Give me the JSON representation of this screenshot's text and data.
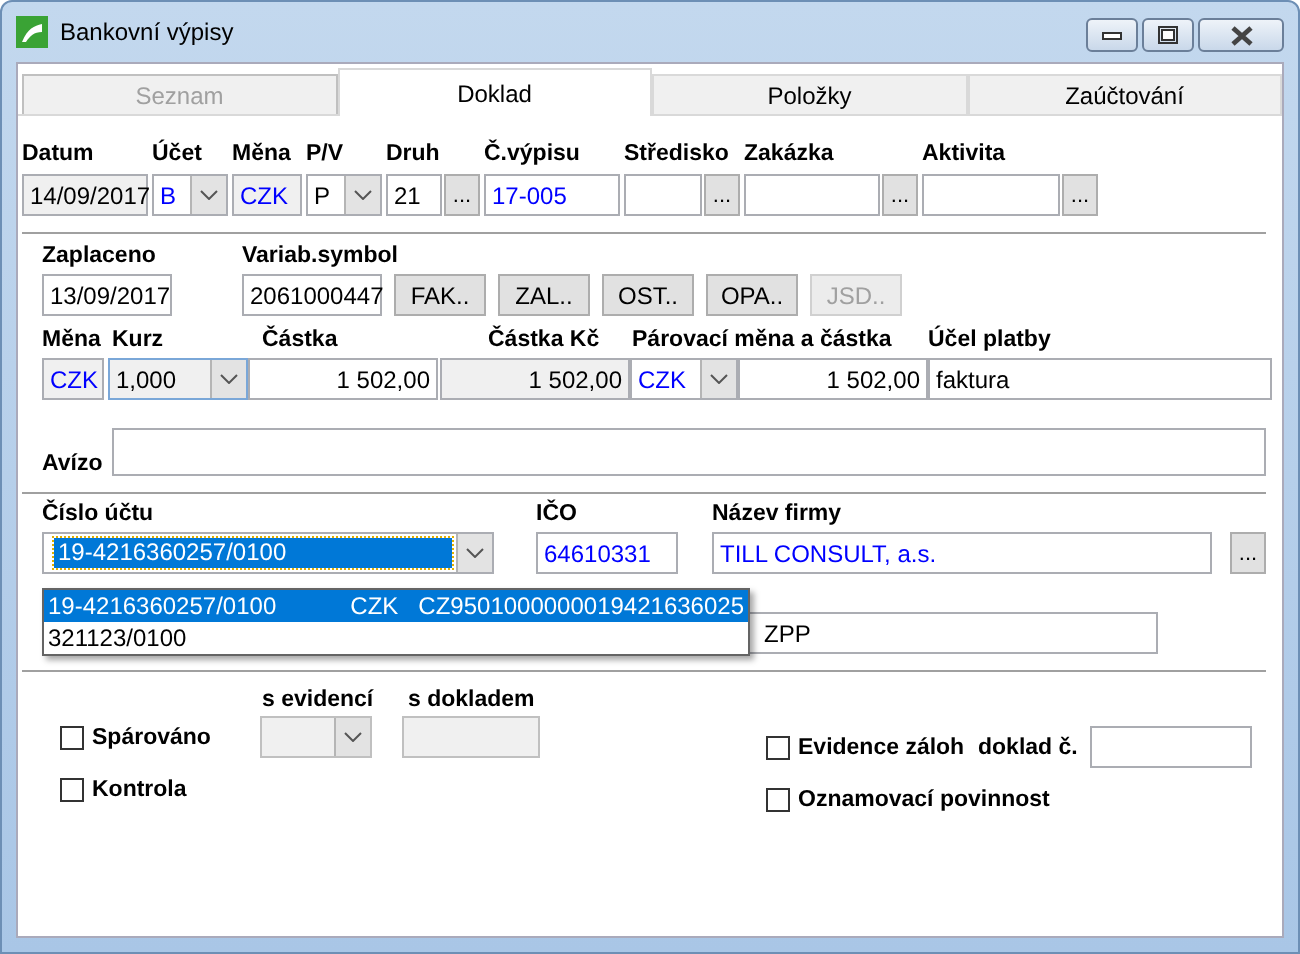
{
  "window": {
    "title": "Bankovní výpisy"
  },
  "tabs": [
    {
      "label": "Seznam",
      "selected": false,
      "disabled": true
    },
    {
      "label": "Doklad",
      "selected": true,
      "disabled": false
    },
    {
      "label": "Položky",
      "selected": false,
      "disabled": false
    },
    {
      "label": "Zaúčtování",
      "selected": false,
      "disabled": false
    }
  ],
  "header_fields": [
    {
      "label": "Datum",
      "value": "14/09/2017",
      "kind": "text",
      "readonly": true,
      "linked": false
    },
    {
      "label": "Účet",
      "value": "B",
      "kind": "combo",
      "readonly": false,
      "linked": true
    },
    {
      "label": "Měna",
      "value": "CZK",
      "kind": "text",
      "readonly": true,
      "linked": true
    },
    {
      "label": "P/V",
      "value": "P",
      "kind": "combo",
      "readonly": false,
      "linked": false
    },
    {
      "label": "Druh",
      "value": "21",
      "kind": "lookup",
      "button": "...",
      "readonly": false,
      "linked": false
    },
    {
      "label": "Č.výpisu",
      "value": "17-005",
      "kind": "text",
      "readonly": false,
      "linked": true
    },
    {
      "label": "Středisko",
      "kind": "lookup",
      "button": "..."
    },
    {
      "label": "Zakázka",
      "kind": "lookup",
      "button": "..."
    },
    {
      "label": "Aktivita",
      "kind": "lookup",
      "button": "..."
    }
  ],
  "payment": {
    "paid_label": "Zaplaceno",
    "paid": "13/09/2017",
    "symbol_label": "Variab.symbol",
    "symbol": "2061000447",
    "buttons": [
      {
        "label": "FAK..",
        "disabled": false
      },
      {
        "label": "ZAL..",
        "disabled": false
      },
      {
        "label": "OST..",
        "disabled": false
      },
      {
        "label": "OPA..",
        "disabled": false
      },
      {
        "label": "JSD..",
        "disabled": true
      }
    ]
  },
  "amounts": {
    "labels": [
      "Měna",
      "Kurz",
      "Částka",
      "Částka Kč",
      "Párovací měna a částka",
      "Účel platby"
    ],
    "currency": "CZK",
    "rate": "1,000",
    "amount": "1 502,00",
    "amount_czk": "1 502,00",
    "pair_currency": "CZK",
    "pair_amount": "1 502,00",
    "purpose": "faktura"
  },
  "avizo": {
    "label": "Avízo"
  },
  "partner": {
    "account_label": "Číslo účtu",
    "account": "19-4216360257/0100",
    "account_focused": true,
    "ico_label": "IČO",
    "ico": "64610331",
    "firm_label": "Název firmy",
    "firm": "TILL CONSULT, a.s.",
    "firm_button": "...",
    "field_2": "ZPP",
    "dropdown": {
      "open": true,
      "options": [
        {
          "account": "19-4216360257/0100",
          "currency": "CZK",
          "iban": "CZ9501000000019421636025",
          "selected": true
        },
        {
          "account": "321123/0100",
          "selected": false
        }
      ]
    }
  },
  "matching": {
    "evidence_label": "s evidencí",
    "document_label": "s dokladem",
    "doc_no_label": "doklad č.",
    "checkboxes": [
      {
        "label": "Spárováno",
        "checked": false
      },
      {
        "label": "Kontrola",
        "checked": false
      },
      {
        "label": "Evidence záloh",
        "checked": false
      },
      {
        "label": "Oznamovací povinnost",
        "checked": false
      }
    ]
  }
}
